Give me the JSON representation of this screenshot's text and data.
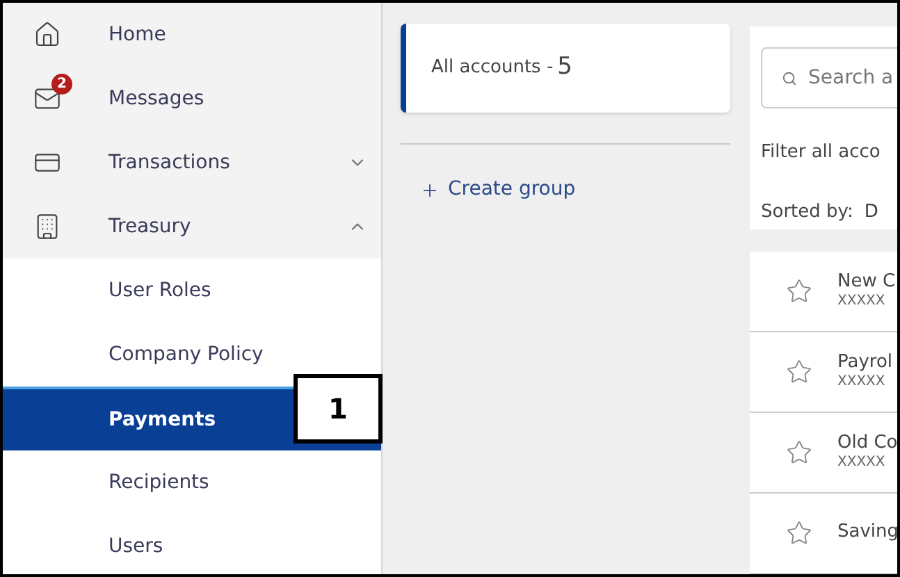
{
  "sidebar": {
    "items": [
      {
        "label": "Home",
        "kind": "home"
      },
      {
        "label": "Messages",
        "kind": "mail",
        "badge": "2"
      },
      {
        "label": "Transactions",
        "kind": "card",
        "expanded": false
      },
      {
        "label": "Treasury",
        "kind": "building",
        "expanded": true,
        "children": [
          {
            "label": "User Roles",
            "selected": false
          },
          {
            "label": "Company Policy",
            "selected": false
          },
          {
            "label": "Payments",
            "selected": true
          },
          {
            "label": "Recipients",
            "selected": false
          },
          {
            "label": "Users",
            "selected": false
          }
        ]
      }
    ]
  },
  "callout": {
    "label": "1"
  },
  "groups": {
    "items": [
      {
        "label": "All accounts - ",
        "count": "5",
        "selected": true
      }
    ],
    "create": "Create group"
  },
  "accounts": {
    "search": {
      "placeholder": "Search a"
    },
    "filter": "Filter all acco",
    "sorted_by": "Sorted by:",
    "sort_value": "D",
    "rows": [
      {
        "name": "New C",
        "number": "XXXXX"
      },
      {
        "name": "Payrol",
        "number": "XXXXX"
      },
      {
        "name": "Old Co",
        "number": "XXXXX"
      },
      {
        "name": "Saving"
      }
    ]
  }
}
